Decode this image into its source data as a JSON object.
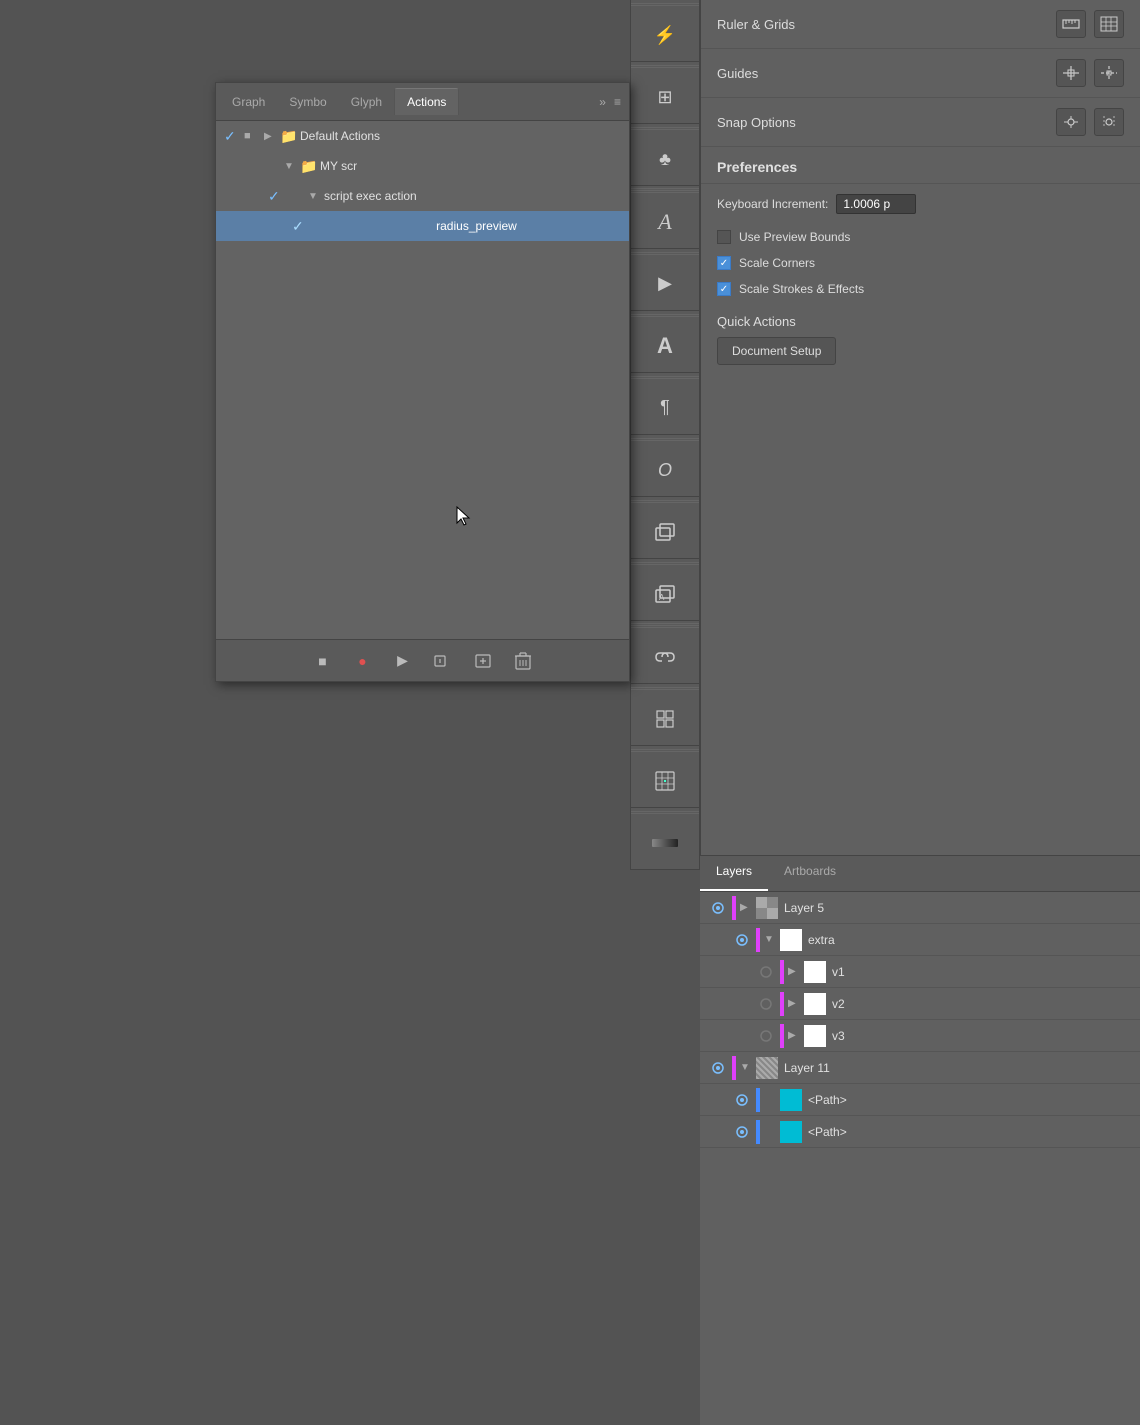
{
  "toolbar": {
    "icons": [
      {
        "name": "flash-icon",
        "symbol": "⚡",
        "group": 1
      },
      {
        "name": "transform-icon",
        "symbol": "⊞",
        "group": 2
      },
      {
        "name": "club-icon",
        "symbol": "♣",
        "group": 3
      },
      {
        "name": "type-icon",
        "symbol": "A",
        "group": 4
      },
      {
        "name": "play-icon",
        "symbol": "▶",
        "group": 5
      },
      {
        "name": "type-large-icon",
        "symbol": "A",
        "group": 6
      },
      {
        "name": "paragraph-icon",
        "symbol": "¶",
        "group": 7
      },
      {
        "name": "italic-icon",
        "symbol": "𝐼",
        "group": 8
      },
      {
        "name": "copy-icon",
        "symbol": "⧉",
        "group": 9
      },
      {
        "name": "copy-type-icon",
        "symbol": "⧉",
        "group": 10
      },
      {
        "name": "link-icon",
        "symbol": "🔗",
        "group": 11
      },
      {
        "name": "grid-icon",
        "symbol": "⊞",
        "group": 12
      },
      {
        "name": "pattern-icon",
        "symbol": "⠿",
        "group": 13
      },
      {
        "name": "gradient-icon",
        "symbol": "▬",
        "group": 14
      }
    ]
  },
  "panel": {
    "tabs": [
      {
        "label": "Graph",
        "active": false
      },
      {
        "label": "Symbo",
        "active": false
      },
      {
        "label": "Glyph",
        "active": false
      },
      {
        "label": "Actions",
        "active": true
      }
    ],
    "more_label": "»",
    "menu_label": "≡",
    "actions": [
      {
        "check": true,
        "stop": true,
        "expand_type": "right",
        "indent": 0,
        "folder": true,
        "label": "Default Actions",
        "selected": false
      },
      {
        "check": false,
        "stop": false,
        "expand_type": "down",
        "indent": 1,
        "folder": true,
        "label": "MY scr",
        "selected": false
      },
      {
        "check": true,
        "stop": false,
        "expand_type": "down",
        "indent": 2,
        "folder": false,
        "label": "script exec action",
        "selected": false
      },
      {
        "check": true,
        "stop": false,
        "expand_type": "none",
        "indent": 3,
        "folder": false,
        "label": "radius_preview",
        "selected": true
      }
    ],
    "toolbar_buttons": [
      {
        "name": "stop-btn",
        "symbol": "■"
      },
      {
        "name": "record-btn",
        "symbol": "●"
      },
      {
        "name": "play-btn",
        "symbol": "▶"
      },
      {
        "name": "folder-btn",
        "symbol": "📁"
      },
      {
        "name": "new-btn",
        "symbol": "＋"
      },
      {
        "name": "delete-btn",
        "symbol": "🗑"
      }
    ]
  },
  "right_panel": {
    "ruler_grids_label": "Ruler & Grids",
    "guides_label": "Guides",
    "snap_options_label": "Snap Options",
    "preferences_label": "Preferences",
    "keyboard_increment_label": "Keyboard Increment:",
    "keyboard_increment_value": "1.0006 p",
    "use_preview_bounds_label": "Use Preview Bounds",
    "use_preview_bounds_checked": false,
    "scale_corners_label": "Scale Corners",
    "scale_corners_checked": true,
    "scale_strokes_effects_label": "Scale Strokes & Effects",
    "scale_strokes_effects_checked": true,
    "quick_actions_label": "Quick Actions",
    "document_setup_btn": "Document Setup"
  },
  "layers_panel": {
    "tabs": [
      {
        "label": "Layers",
        "active": true
      },
      {
        "label": "Artboards",
        "active": false
      }
    ],
    "layers": [
      {
        "visible": true,
        "color": "#e040fb",
        "expand": "right",
        "indent": 0,
        "thumb_type": "layer5",
        "name": "Layer 5"
      },
      {
        "visible": true,
        "color": "#e040fb",
        "expand": "down",
        "indent": 1,
        "thumb_type": "white",
        "name": "extra"
      },
      {
        "visible": false,
        "color": "#e040fb",
        "expand": "right",
        "indent": 2,
        "thumb_type": "white",
        "name": "v1"
      },
      {
        "visible": false,
        "color": "#e040fb",
        "expand": "right",
        "indent": 2,
        "thumb_type": "white",
        "name": "v2"
      },
      {
        "visible": false,
        "color": "#e040fb",
        "expand": "right",
        "indent": 2,
        "thumb_type": "white",
        "name": "v3"
      },
      {
        "visible": true,
        "color": "#e040fb",
        "expand": "down",
        "indent": 0,
        "thumb_type": "layer11",
        "name": "Layer 11"
      },
      {
        "visible": true,
        "color": "#448aff",
        "expand": "none",
        "indent": 1,
        "thumb_type": "cyan",
        "name": "<Path>"
      },
      {
        "visible": true,
        "color": "#448aff",
        "expand": "none",
        "indent": 1,
        "thumb_type": "cyan",
        "name": "<Path>"
      }
    ]
  }
}
